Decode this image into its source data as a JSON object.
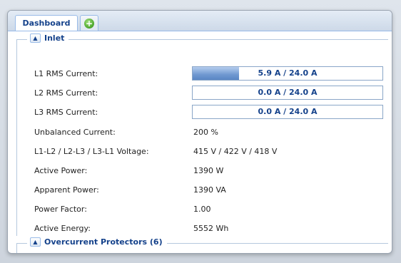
{
  "tabs": {
    "dashboard_label": "Dashboard",
    "add_icon": "plus-circle-icon"
  },
  "inlet": {
    "title": "Inlet",
    "rows": [
      {
        "label": "L1 RMS Current:",
        "bar_text": "5.9 A / 24.0 A",
        "fraction": 0.246
      },
      {
        "label": "L2 RMS Current:",
        "bar_text": "0.0 A / 24.0 A",
        "fraction": 0.0
      },
      {
        "label": "L3 RMS Current:",
        "bar_text": "0.0 A / 24.0 A",
        "fraction": 0.0
      },
      {
        "label": "Unbalanced Current:",
        "value": "200 %"
      },
      {
        "label": "L1-L2 / L2-L3 / L3-L1 Voltage:",
        "value": "415 V / 422 V / 418 V"
      },
      {
        "label": "Active Power:",
        "value": "1390 W"
      },
      {
        "label": "Apparent Power:",
        "value": "1390 VA"
      },
      {
        "label": "Power Factor:",
        "value": "1.00"
      },
      {
        "label": "Active Energy:",
        "value": "5552 Wh"
      }
    ]
  },
  "overcurrent": {
    "title": "Overcurrent Protectors (6)"
  },
  "colors": {
    "accent": "#15428b",
    "bar_fill": "#6f98d0",
    "add_green": "#4aa52a"
  }
}
